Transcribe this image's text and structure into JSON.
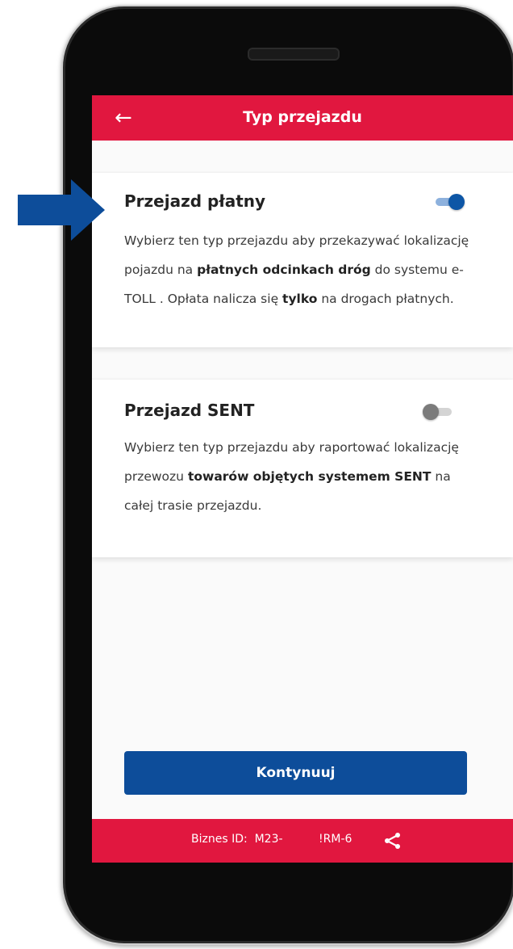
{
  "app_bar": {
    "back_icon": "arrow-left-icon",
    "title": "Typ przejazdu"
  },
  "options": [
    {
      "title": "Przejazd płatny",
      "toggle_on": true,
      "desc": {
        "t1": "Wybierz ten typ przejazdu aby przekazywać lokalizację pojazdu na ",
        "b1": "płatnych odcinkach dróg",
        "t2": " do systemu e-TOLL . Opłata nalicza się ",
        "b2": "tylko",
        "t3": " na drogach płatnych."
      }
    },
    {
      "title": "Przejazd SENT",
      "toggle_on": false,
      "desc": {
        "t1": "Wybierz ten typ przejazdu aby raportować lokalizację przewozu ",
        "b1": "towarów objętych systemem SENT",
        "t2": " na całej trasie przejazdu."
      }
    }
  ],
  "continue_button": "Kontynuuj",
  "footer": {
    "text": "Biznes ID:  M23-          !RM-6",
    "share_icon": "share-icon"
  },
  "colors": {
    "brand_red": "#e1173f",
    "primary_blue": "#0d4d9a",
    "annotation_arrow": "#0d4d9a"
  },
  "annotation_arrow_icon": "right-arrow-icon"
}
